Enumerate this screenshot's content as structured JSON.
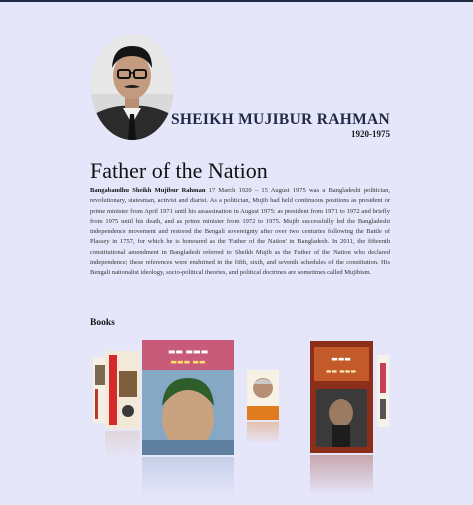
{
  "profile": {
    "name": "SHEIKH MUJIBUR RAHMAN",
    "years": "1920-1975",
    "portrait_icon": "portrait-photo"
  },
  "section": {
    "title": "Father of the Nation",
    "bio_lead": "Bangabandhu Sheikh Mujibur Rahman",
    "bio_text": " 17 March 1920 – 15 August 1975 was a Bangladeshi politician, revolutionary, statesman, activist and diarist. As a politician, Mujib had held continuous positions as president or prime minister from April 1971 until his assassination in August 1975: as president from 1971 to 1972 and briefly from 1975 until his death, and as prime minister from 1972 to 1975. Mujib successfully led the Bangladeshi independence movement and restored the Bengali sovereignty after over two centuries following the Battle of Plassey in 1757, for which he is honoured as the 'Father of the Nation' in Bangladesh. In 2011, the fifteenth constitutional amendment in Bangladesh referred to Sheikh Mujib as the Father of the Nation who declared independence; these references were enshrined in the fifth, sixth, and seventh schedules of the constitution. His Bengali nationalist ideology, socio-political theories, and political doctrines are sometimes called Mujibism."
  },
  "books": {
    "title": "Books",
    "items": [
      {
        "id": "book-1",
        "color": "#b83a2e"
      },
      {
        "id": "book-2",
        "color": "#d62a2a"
      },
      {
        "id": "book-3",
        "color": "#3f6b2f"
      },
      {
        "id": "book-4",
        "color": "#e07b1e"
      },
      {
        "id": "book-5",
        "color": "#8a2a17"
      },
      {
        "id": "book-6",
        "color": "#c7405a"
      }
    ]
  },
  "colors": {
    "background": "#e6e6fb",
    "heading": "#202a46"
  }
}
